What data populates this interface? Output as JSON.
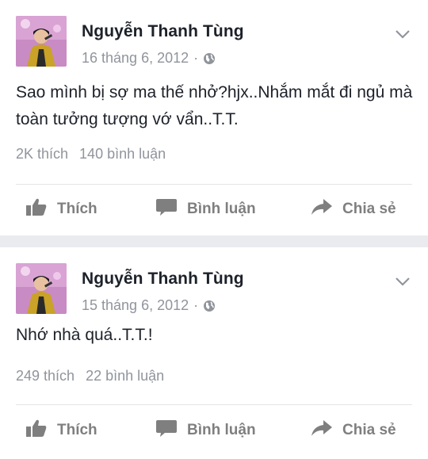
{
  "posts": [
    {
      "author": "Nguyễn Thanh Tùng",
      "date": "16 tháng 6, 2012",
      "separator": "·",
      "text": "Sao mình bị sợ ma thế nhở?hjx..Nhắm mắt đi ngủ mà toàn tưởng tượng vớ vẩn..T.T.",
      "likes": "2K thích",
      "comments": "140 bình luận"
    },
    {
      "author": "Nguyễn Thanh Tùng",
      "date": "15 tháng 6, 2012",
      "separator": "·",
      "text": "Nhớ nhà quá..T.T.!",
      "likes": "249 thích",
      "comments": "22 bình luận"
    }
  ],
  "actions": {
    "like": "Thích",
    "comment": "Bình luận",
    "share": "Chia sẻ"
  },
  "icons": [
    "avatar",
    "globe-icon",
    "chevron-down-icon",
    "like-icon",
    "comment-icon",
    "share-icon"
  ],
  "colors": {
    "background": "#e9ebee",
    "card": "#ffffff",
    "text": "#1d2129",
    "meta": "#90949c",
    "action": "#7f7f7f"
  }
}
